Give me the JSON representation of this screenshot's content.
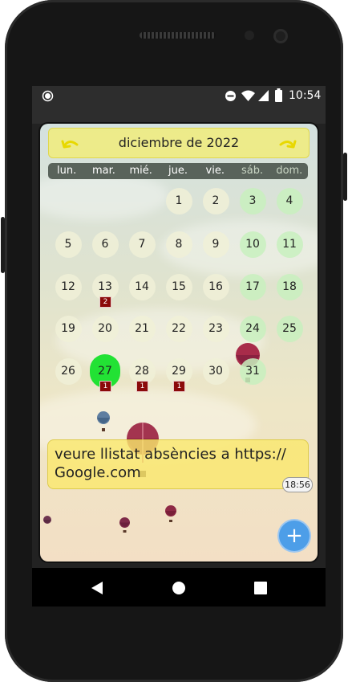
{
  "status_bar": {
    "time": "10:54",
    "icons": [
      "record-icon",
      "dnd-icon",
      "wifi-icon",
      "signal-icon",
      "battery-icon"
    ]
  },
  "calendar": {
    "month_title": "diciembre de 2022",
    "weekdays": [
      "lun.",
      "mar.",
      "mié.",
      "jue.",
      "vie.",
      "sáb.",
      "dom."
    ],
    "weeks": [
      [
        "",
        "",
        "",
        "1",
        "2",
        "3",
        "4"
      ],
      [
        "5",
        "6",
        "7",
        "8",
        "9",
        "10",
        "11"
      ],
      [
        "12",
        "13",
        "14",
        "15",
        "16",
        "17",
        "18"
      ],
      [
        "19",
        "20",
        "21",
        "22",
        "23",
        "24",
        "25"
      ],
      [
        "26",
        "27",
        "28",
        "29",
        "30",
        "31",
        ""
      ]
    ],
    "today": "27",
    "badges": {
      "13": "2",
      "27": "1",
      "28": "1",
      "29": "1"
    },
    "colors": {
      "weekday_bg": "#f0f0d7",
      "weekend_bg": "#c8f0be",
      "today_bg": "#22e234",
      "badge_bg": "#8b0a0a",
      "header_bar": "#f4ee6e"
    }
  },
  "note": {
    "text_line1": "veure llistat absències a https://",
    "text_line2": "Google.com",
    "time": "18:56"
  },
  "fab": {
    "label": "+"
  }
}
